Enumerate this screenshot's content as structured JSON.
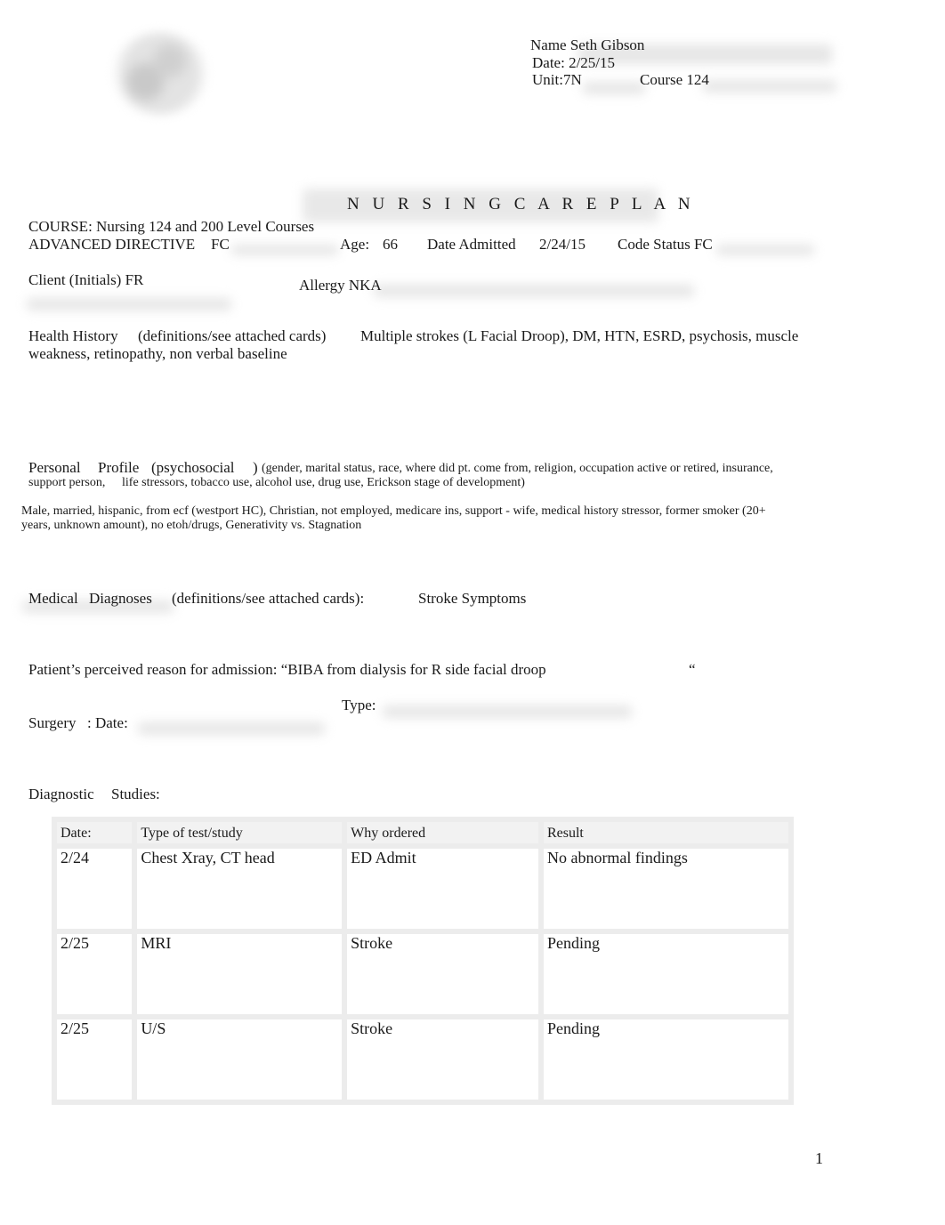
{
  "header": {
    "name_label": "Name Seth Gibson",
    "date_label": "Date: 2/25/15",
    "unit_label": "Unit:7N",
    "course_label": "Course 124"
  },
  "title": "N U R S I N G C A R E P L A N",
  "course": "COURSE: Nursing 124 and 200 Level Courses",
  "advanced_directive": {
    "label": "ADVANCED DIRECTIVE",
    "value": "FC"
  },
  "age": {
    "label": "Age:",
    "value": "66"
  },
  "date_admitted": {
    "label": "Date Admitted",
    "value": "2/24/15"
  },
  "code_status": "Code Status FC",
  "client_initials": "Client (Initials) FR",
  "allergy": "Allergy NKA",
  "health_history": {
    "label": "Health History",
    "note": "(definitions/see attached cards)",
    "value_line1": "Multiple strokes (L Facial Droop), DM, HTN, ESRD, psychosis, muscle",
    "value_line2": "weakness, retinopathy, non verbal baseline"
  },
  "personal_profile": {
    "label1": "Personal",
    "label2": "Profile",
    "label3": "(psychosocial",
    "close": ")",
    "prompt_line1": "(gender, marital status, race, where did pt. come from, religion, occupation active or retired, insurance,",
    "prompt_line2a": "support person,",
    "prompt_line2b": "life stressors, tobacco use, alcohol use, drug use, Erickson stage of development)",
    "value_line1": "Male, married, hispanic, from ecf (westport HC), Christian, not employed, medicare ins, support - wife, medical history stressor, former smoker (20+",
    "value_line2": "years, unknown amount), no etoh/drugs, Generativity vs. Stagnation"
  },
  "medical_diagnoses": {
    "label1": "Medical",
    "label2": "Diagnoses",
    "note": "(definitions/see attached cards):",
    "value": "Stroke Symptoms"
  },
  "admission_reason": {
    "text": "Patient’s perceived reason for admission: “BIBA from dialysis for R side facial droop",
    "close_quote": "“"
  },
  "surgery": {
    "type_label": "Type:",
    "label": "Surgery",
    "date_label": ": Date:"
  },
  "diagnostic_studies": {
    "label1": "Diagnostic",
    "label2": "Studies:",
    "columns": [
      "Date:",
      "Type of test/study",
      "Why ordered",
      "Result"
    ],
    "rows": [
      [
        "2/24",
        "Chest Xray, CT head",
        "ED Admit",
        "No abnormal findings"
      ],
      [
        "2/25",
        "MRI",
        "Stroke",
        "Pending"
      ],
      [
        "2/25",
        "U/S",
        "Stroke",
        "Pending"
      ]
    ]
  },
  "page_number": "1"
}
